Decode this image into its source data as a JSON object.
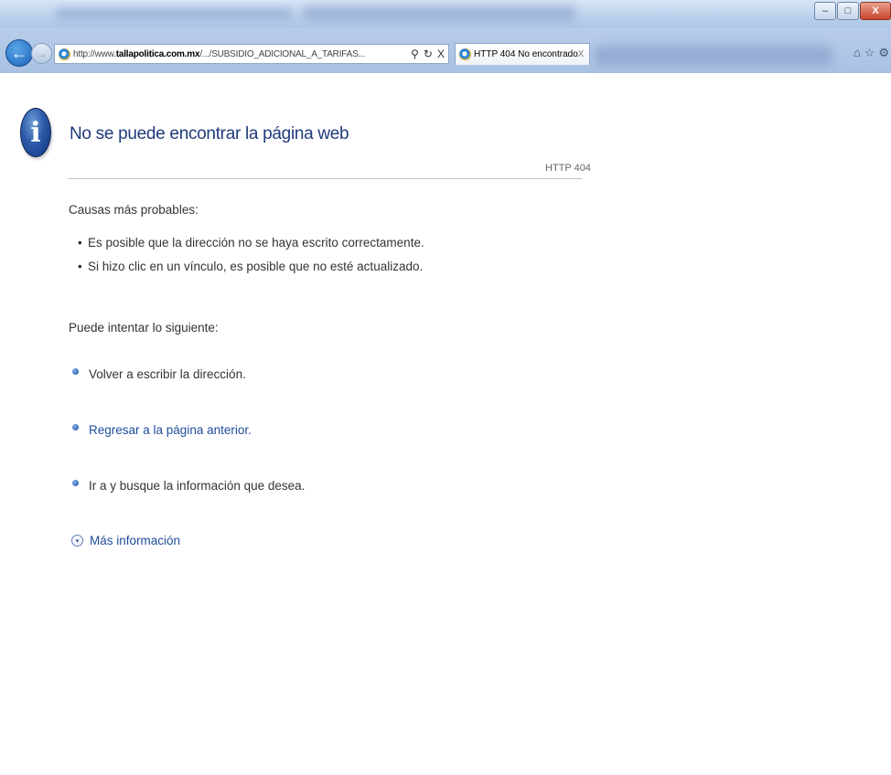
{
  "window": {
    "minimize_label": "–",
    "restore_label": "□",
    "close_label": "X"
  },
  "toolbar": {
    "address_prefix": "http://www.",
    "address_domain": "tallapolitica.com.mx",
    "address_path": "/.../SUBSIDIO_ADICIONAL_A_TARIFAS...",
    "search_glyph": "⚲",
    "refresh_glyph": "↻",
    "stop_glyph": "X",
    "back_glyph": "←",
    "forward_glyph": "→"
  },
  "tab": {
    "label": "HTTP 404 No encontrado",
    "close": "X"
  },
  "right_tools": {
    "home_glyph": "⌂",
    "favorites_glyph": "☆",
    "settings_glyph": "⚙"
  },
  "page": {
    "info_glyph": "i",
    "title": "No se puede encontrar la página web",
    "http_code": "HTTP 404",
    "causes_heading": "Causas más probables:",
    "causes": [
      "Es posible que la dirección no se haya escrito correctamente.",
      "Si hizo clic en un vínculo, es posible que no esté actualizado."
    ],
    "try_heading": "Puede intentar lo siguiente:",
    "options": [
      "Volver a escribir la dirección.",
      "Regresar a la página anterior.",
      "Ir a  y busque la información que desea."
    ],
    "more_info": "Más información",
    "more_info_glyph": "▾"
  }
}
